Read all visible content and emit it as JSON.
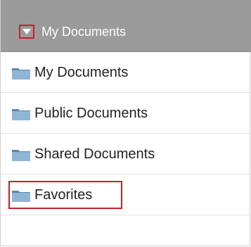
{
  "header": {
    "title": "My Documents",
    "toggle_icon": "triangle-down-icon",
    "highlight_color": "#c8202a"
  },
  "folders": [
    {
      "label": "My Documents",
      "icon": "folder-icon"
    },
    {
      "label": "Public Documents",
      "icon": "folder-icon"
    },
    {
      "label": "Shared Documents",
      "icon": "folder-icon"
    },
    {
      "label": "Favorites",
      "icon": "folder-icon",
      "highlighted": true
    }
  ],
  "colors": {
    "header_bg": "#9b9b9b",
    "folder_blue": "#7ea9c9"
  }
}
